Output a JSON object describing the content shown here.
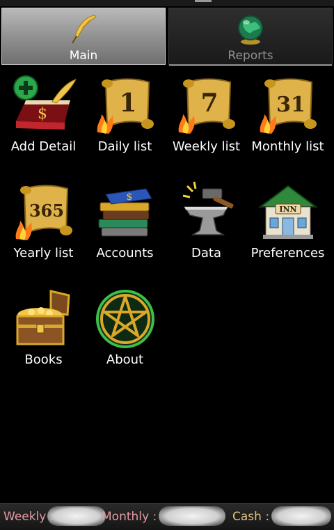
{
  "tabs": [
    {
      "label": "Main",
      "icon": "quill-icon",
      "active": true
    },
    {
      "label": "Reports",
      "icon": "globe-icon",
      "active": false
    }
  ],
  "tiles": [
    {
      "label": "Add Detail",
      "icon": "ledger-add-icon"
    },
    {
      "label": "Daily list",
      "icon": "scroll-1-icon",
      "number": "1"
    },
    {
      "label": "Weekly list",
      "icon": "scroll-7-icon",
      "number": "7"
    },
    {
      "label": "Monthly list",
      "icon": "scroll-31-icon",
      "number": "31"
    },
    {
      "label": "Yearly list",
      "icon": "scroll-365-icon",
      "number": "365"
    },
    {
      "label": "Accounts",
      "icon": "books-stack-icon"
    },
    {
      "label": "Data",
      "icon": "anvil-hammer-icon"
    },
    {
      "label": "Preferences",
      "icon": "inn-icon",
      "sign": "INN"
    },
    {
      "label": "Books",
      "icon": "treasure-chest-icon"
    },
    {
      "label": "About",
      "icon": "pentagram-icon"
    }
  ],
  "status": {
    "weekly_label": "Weekly :",
    "monthly_label": "Monthly :",
    "cash_label": "Cash :"
  },
  "colors": {
    "background": "#000000",
    "status_pink": "#e39aa3",
    "status_gold": "#e3c37a",
    "gold": "#d9a72a"
  }
}
